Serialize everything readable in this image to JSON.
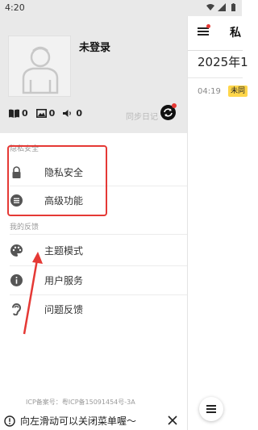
{
  "status_bar": {
    "time": "4:20"
  },
  "drawer": {
    "username": "未登录",
    "stats": [
      {
        "icon": "book-icon",
        "value": "0"
      },
      {
        "icon": "image-icon",
        "value": "0"
      },
      {
        "icon": "volume-icon",
        "value": "0"
      }
    ],
    "sync_label": "同步日记",
    "section_privacy": "隐私安全",
    "menu_privacy": [
      {
        "label": "隐私安全",
        "icon": "lock-icon"
      },
      {
        "label": "高级功能",
        "icon": "list-icon"
      }
    ],
    "section_feedback": "我的反馈",
    "menu_feedback": [
      {
        "label": "主题模式",
        "icon": "palette-icon"
      },
      {
        "label": "用户服务",
        "icon": "info-icon"
      },
      {
        "label": "问题反馈",
        "icon": "ear-icon"
      }
    ],
    "icp": "ICP备案号：粤ICP备15091454号-3A",
    "tip": "向左滑动可以关闭菜单喔～"
  },
  "main": {
    "title": "私",
    "date": "2025年1",
    "entry_time": "04:19",
    "entry_badge": "未同"
  },
  "colors": {
    "accent_red": "#e53935",
    "badge_yellow": "#ffd64a",
    "header_gray": "#e9e9e9"
  }
}
